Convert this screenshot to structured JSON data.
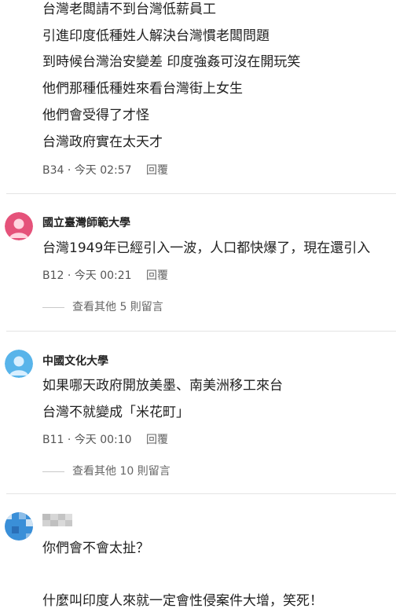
{
  "comments": [
    {
      "lines": [
        "台灣老闆請不到台灣低薪員工",
        "引進印度低種姓人解決台灣慣老闆問題",
        "到時候台灣治安變差 印度強姦可沒在開玩笑",
        "他們那種低種姓來看台灣街上女生",
        "他們會受得了才怪",
        "台灣政府實在太天才"
      ],
      "floor": "B34",
      "time": "今天 02:57",
      "reply": "回覆"
    },
    {
      "author": "國立臺灣師範大學",
      "lines": [
        "台灣1949年已經引入一波，人口都快爆了，現在還引入"
      ],
      "floor": "B12",
      "time": "今天 00:21",
      "reply": "回覆",
      "more": "查看其他 5 則留言",
      "avatar_color": "#e5527a"
    },
    {
      "author": "中國文化大學",
      "lines": [
        "如果哪天政府開放美墨、南美洲移工來台",
        "台灣不就變成「米花町」"
      ],
      "floor": "B11",
      "time": "今天 00:10",
      "reply": "回覆",
      "more": "查看其他 10 則留言",
      "avatar_color": "#58b4ea"
    },
    {
      "lines": [
        "你們會不會太扯？",
        "什麼叫印度人來就一定會性侵案件大增，笑死！"
      ],
      "avatar_color": "#3a8fd8"
    }
  ],
  "meta_separator": "·"
}
